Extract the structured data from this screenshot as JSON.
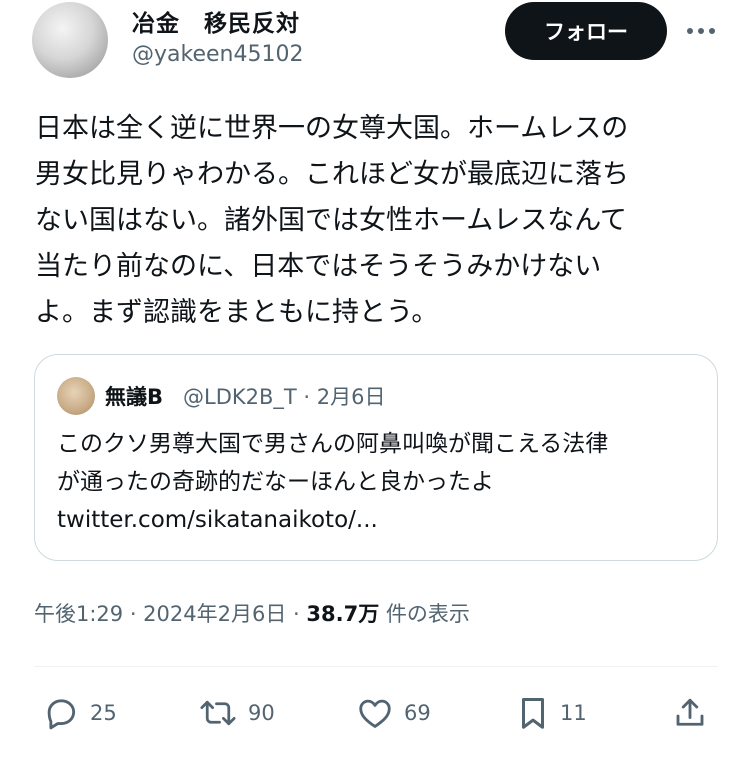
{
  "author": {
    "display_name": "冶金　移民反対",
    "handle": "@yakeen45102"
  },
  "header": {
    "follow_label": "フォロー",
    "more_icon": "more-icon"
  },
  "tweet": {
    "text": "日本は全く逆に世界一の女尊大国。ホームレスの\n男女比見りゃわかる。これほど女が最底辺に落ち\nない国はない。諸外国では女性ホームレスなんて\n当たり前なのに、日本ではそうそうみかけない\nよ。まず認識をまともに持とう。"
  },
  "quote": {
    "display_name": "無議B",
    "meta": "@LDK2B_T · 2月6日",
    "text": "このクソ男尊大国で男さんの阿鼻叫喚が聞こえる法律\nが通ったの奇跡的だなーほんと良かったよ\ntwitter.com/sikatanaikoto/..."
  },
  "meta": {
    "time_date": "午後1:29 · 2024年2月6日 · ",
    "views": "38.7万",
    "views_label": " 件の表示"
  },
  "actions": {
    "reply_count": "25",
    "retweet_count": "90",
    "like_count": "69",
    "bookmark_count": "11"
  },
  "colors": {
    "text": "#0f1419",
    "secondary": "#536471",
    "border": "#cfd9de",
    "button": "#0f1419"
  }
}
